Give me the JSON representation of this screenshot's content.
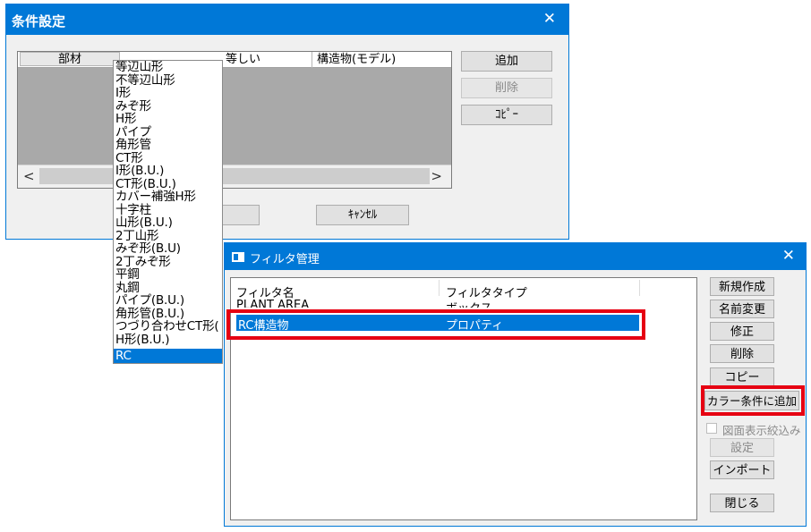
{
  "dialog_conditions": {
    "title": "条件設定",
    "close_glyph": "✕",
    "grid_headers": [
      "部材",
      "等しい",
      "構造物(モデル)"
    ],
    "buttons": {
      "add": "追加",
      "delete": "削除",
      "copy": "ｺﾋﾟｰ",
      "cancel": "ｷｬﾝｾﾙ"
    },
    "scroll_left": "<",
    "scroll_right": ">"
  },
  "dropdown": {
    "items": [
      "等辺山形",
      "不等辺山形",
      "I形",
      "みぞ形",
      "H形",
      "パイプ",
      "角形管",
      "CT形",
      "I形(B.U.)",
      "CT形(B.U.)",
      "カバー補強H形",
      "十字柱",
      "山形(B.U.)",
      "2丁山形",
      "みぞ形(B.U)",
      "2丁みぞ形",
      "平鋼",
      "丸鋼",
      "パイプ(B.U.)",
      "角形管(B.U.)",
      "つづり合わせCT形(",
      "H形(B.U.)",
      "RC"
    ],
    "selected": "RC"
  },
  "dialog_filter": {
    "title": "フィルタ管理",
    "close_glyph": "✕",
    "columns": [
      "フィルタ名",
      "フィルタタイプ"
    ],
    "rows": [
      {
        "name": "PLANT AREA",
        "type": "ボックス"
      },
      {
        "name": "RC構造物",
        "type": "プロパティ",
        "selected": true
      }
    ],
    "buttons": {
      "new": "新規作成",
      "rename": "名前変更",
      "modify": "修正",
      "delete": "削除",
      "copy": "コピー",
      "add_color": "カラー条件に追加",
      "drawing_filter": "図面表示絞込み",
      "settings": "設定",
      "import": "インポート",
      "close": "閉じる"
    }
  },
  "colors": {
    "accent": "#0078d7",
    "highlight_box": "#e60012",
    "grid_bg": "#a9a9a9"
  }
}
